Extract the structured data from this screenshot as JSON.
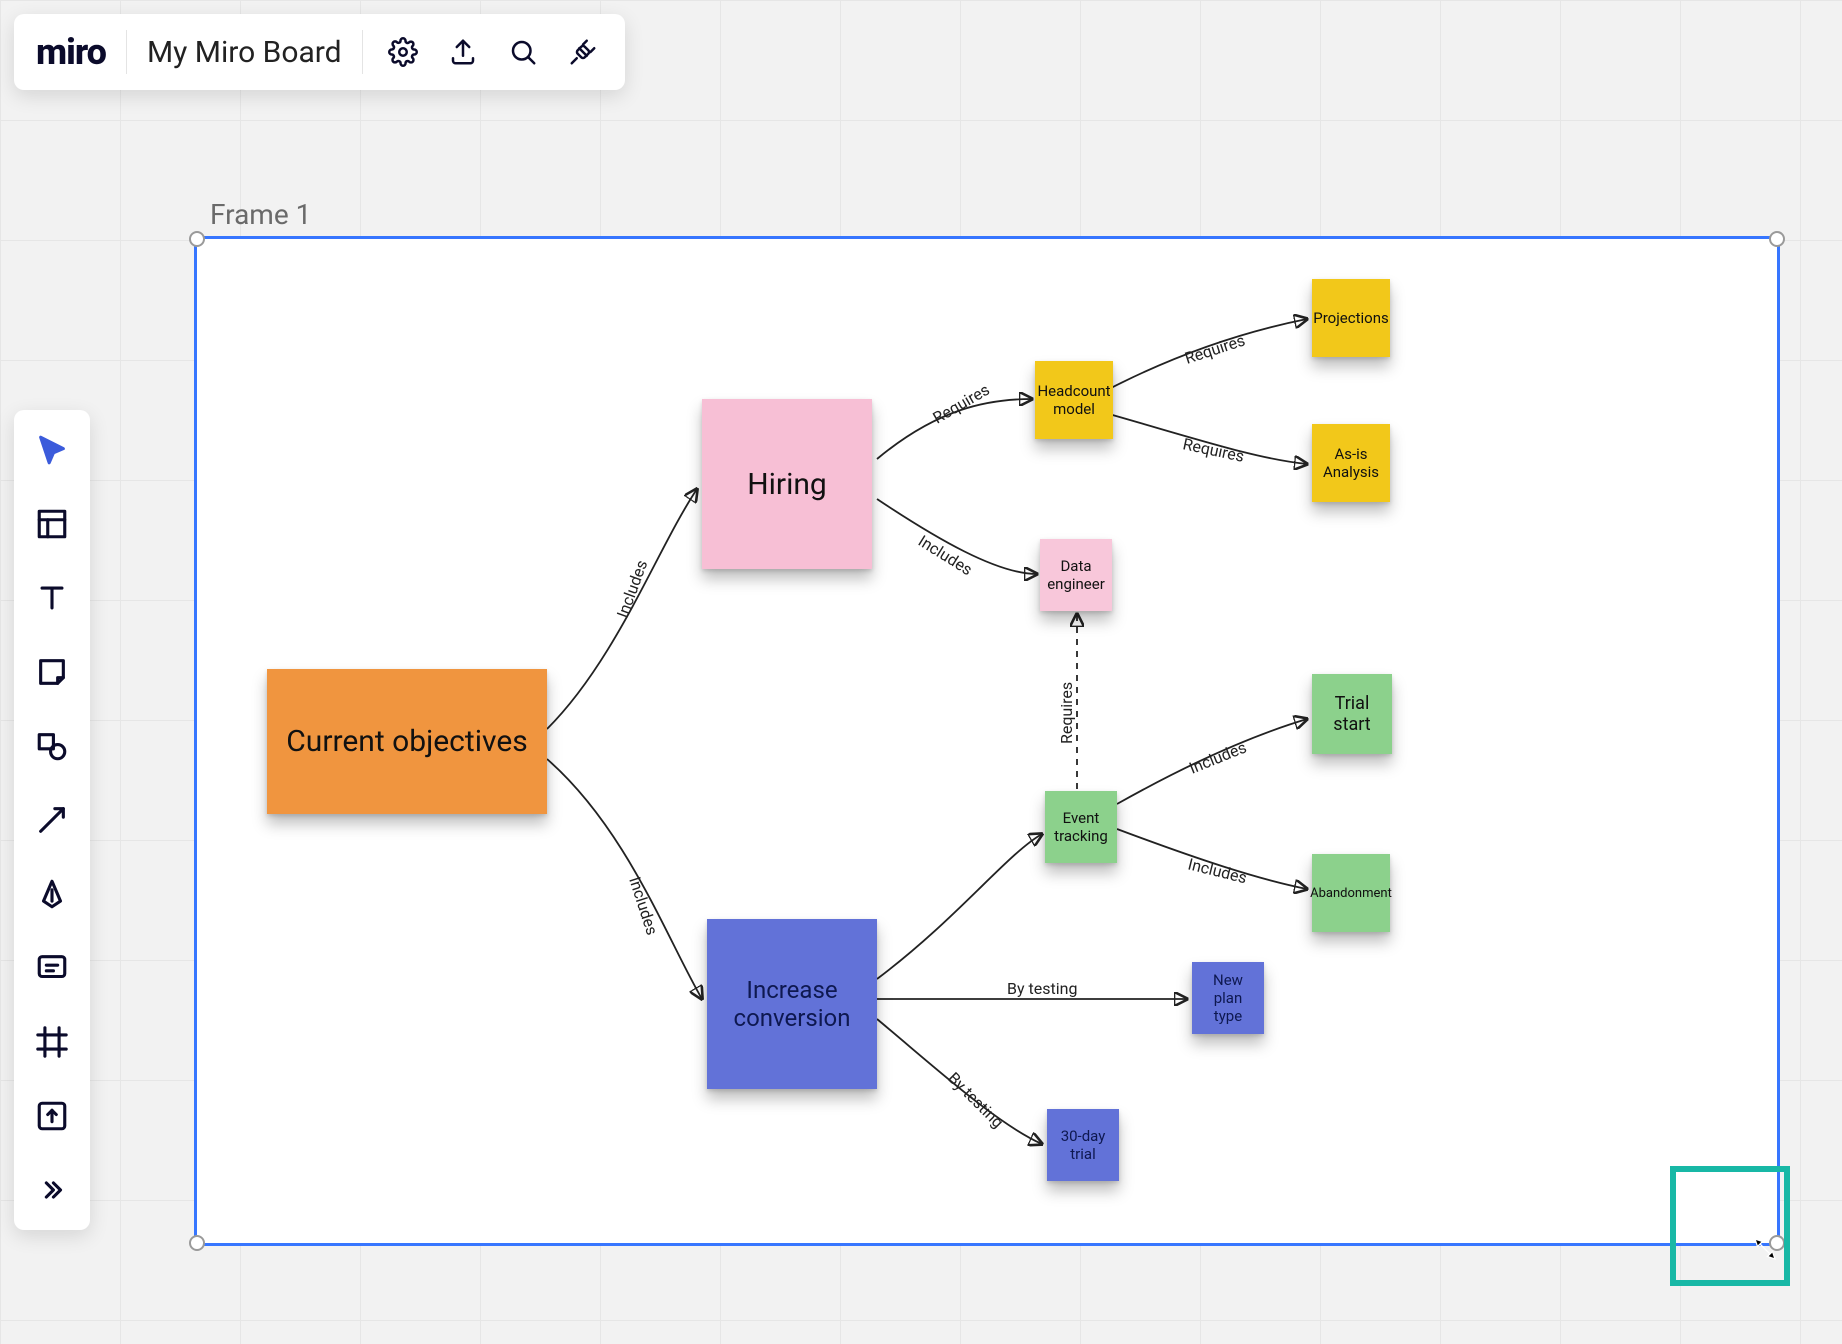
{
  "app": {
    "logo": "miro",
    "board_name": "My Miro Board"
  },
  "topbar_icons": {
    "settings": "settings-icon",
    "export": "export-icon",
    "search": "search-icon",
    "plug": "plug-icon"
  },
  "left_tools": {
    "select": "Select",
    "templates": "Templates",
    "text": "Text",
    "sticky": "Sticky note",
    "shapes": "Shapes",
    "line": "Connection line",
    "pen": "Pen",
    "comment": "Comment",
    "frame": "Frame",
    "upload": "Upload",
    "more": "More tools"
  },
  "frame": {
    "label": "Frame 1"
  },
  "stickies": {
    "root": {
      "text": "Current objectives",
      "color": "#f0953f"
    },
    "hiring": {
      "text": "Hiring",
      "color": "#f7bfd5"
    },
    "conv": {
      "text": "Increase conversion",
      "color": "#6272d8"
    },
    "headcount": {
      "text": "Headcount model",
      "color": "#f2c81a"
    },
    "dataeng": {
      "text": "Data engineer",
      "color": "#f8c7da"
    },
    "proj": {
      "text": "Projections",
      "color": "#f2c81a"
    },
    "asis": {
      "text": "As-is Analysis",
      "color": "#f2c81a"
    },
    "event": {
      "text": "Event tracking",
      "color": "#8cd18c"
    },
    "trial": {
      "text": "Trial start",
      "color": "#8cd18c"
    },
    "aband": {
      "text": "Abandonment",
      "color": "#8cd18c"
    },
    "plan": {
      "text": "New plan type",
      "color": "#6272d8"
    },
    "trial30": {
      "text": "30-day trial",
      "color": "#6272d8"
    }
  },
  "edges": {
    "includes": "Includes",
    "requires": "Requires",
    "bytesting": "By testing"
  }
}
